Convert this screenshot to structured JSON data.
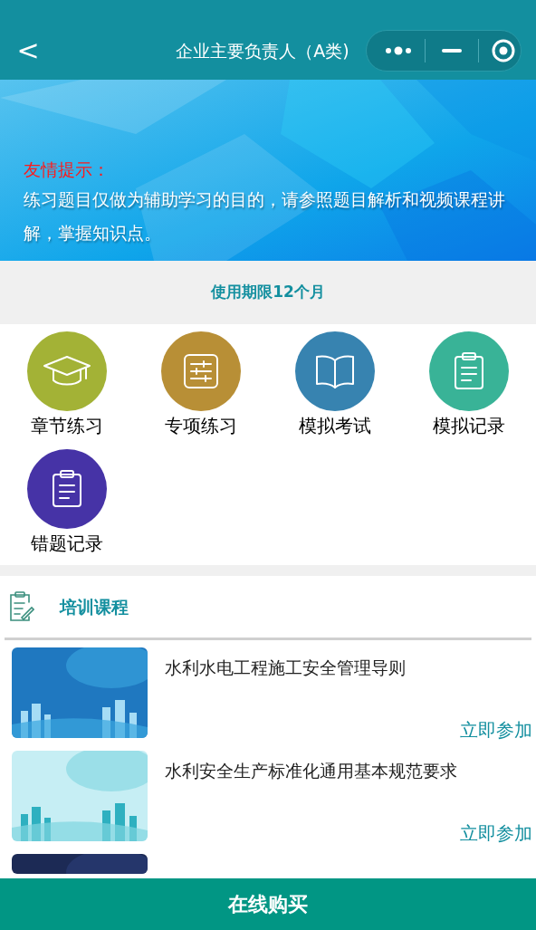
{
  "header": {
    "back": "<",
    "title": "企业主要负责人（A类)"
  },
  "notice": {
    "label": "友情提示：",
    "text": "练习题目仅做为辅助学习的目的，请参照题目解析和视频课程讲解，掌握知识点。"
  },
  "validity": "使用期限12个月",
  "modules": [
    {
      "kind": "cap",
      "label": "章节练习",
      "color": "#a3b236"
    },
    {
      "kind": "sliders",
      "label": "专项练习",
      "color": "#b88f36"
    },
    {
      "kind": "book",
      "label": "模拟考试",
      "color": "#3783b0"
    },
    {
      "kind": "clipboard",
      "label": "模拟记录",
      "color": "#39b397"
    },
    {
      "kind": "clipboard",
      "label": "错题记录",
      "color": "#4633a6"
    }
  ],
  "courses_section": {
    "title": "培训课程"
  },
  "courses": [
    {
      "kind": "course",
      "title": "水利水电工程施工安全管理导则",
      "action": "立即参加"
    },
    {
      "kind": "course",
      "title": "水利安全生产标准化通用基本规范要求",
      "action": "立即参加"
    },
    {
      "kind": "picture"
    }
  ],
  "buy_button": "在线购买"
}
